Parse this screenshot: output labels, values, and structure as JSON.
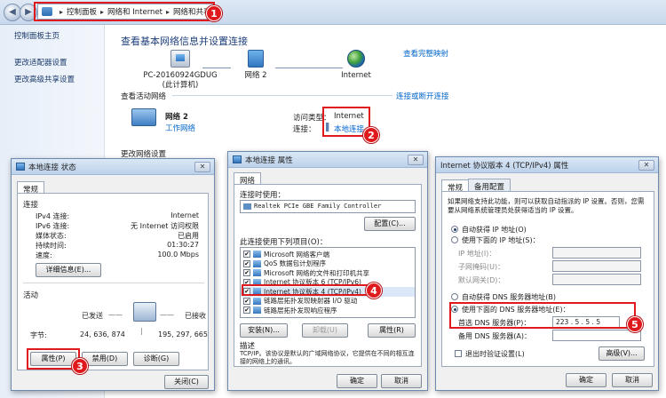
{
  "explorer": {
    "breadcrumb": [
      "控制面板",
      "网络和 Internet",
      "网络和共享中心"
    ],
    "leftnav": [
      "控制面板主页",
      "更改适配器设置",
      "更改高级共享设置"
    ],
    "title": "查看基本网络信息并设置连接",
    "full_map_link": "查看完整映射",
    "map": {
      "pc_name": "PC-20160924GDUG",
      "pc_sub": "(此计算机)",
      "network": "网络  2",
      "internet": "Internet"
    },
    "active_header": "查看活动网络",
    "connect_link": "连接或断开连接",
    "active": {
      "name": "网络  2",
      "type": "工作网络",
      "access_label": "访问类型：",
      "access_value": "Internet",
      "conn_label": "连接：",
      "conn_value": "本地连接"
    },
    "change_header": "更改网络设置"
  },
  "status_dialog": {
    "title": "本地连接 状态",
    "tab": "常规",
    "connection_group": "连接",
    "rows": [
      {
        "label": "IPv4 连接:",
        "value": "Internet"
      },
      {
        "label": "IPv6 连接:",
        "value": "无 Internet 访问权限"
      },
      {
        "label": "媒体状态:",
        "value": "已启用"
      },
      {
        "label": "持续时间:",
        "value": "01:30:27"
      },
      {
        "label": "速度:",
        "value": "100.0 Mbps"
      }
    ],
    "details_btn": "详细信息(E)...",
    "activity_group": "活动",
    "sent_label": "已发送",
    "recv_label": "已接收",
    "bytes_label": "字节:",
    "bytes_sent": "24, 636, 874",
    "bytes_recv": "195, 297, 665",
    "properties_btn": "属性(P)",
    "disable_btn": "禁用(D)",
    "diagnose_btn": "诊断(G)",
    "close_btn": "关闭(C)"
  },
  "props_dialog": {
    "title": "本地连接 属性",
    "tab": "网络",
    "connect_using_label": "连接时使用：",
    "adapter": "Realtek PCIe GBE Family Controller",
    "configure_btn": "配置(C)...",
    "items_label": "此连接使用下列项目(O)：",
    "items": [
      {
        "label": "Microsoft 网络客户端",
        "checked": true
      },
      {
        "label": "QoS 数据包计划程序",
        "checked": true
      },
      {
        "label": "Microsoft 网络的文件和打印机共享",
        "checked": true
      },
      {
        "label": "Internet 协议版本 6 (TCP/IPv6)",
        "checked": true
      },
      {
        "label": "Internet 协议版本 4 (TCP/IPv4)",
        "checked": true
      },
      {
        "label": "链路层拓扑发现映射器 I/O 驱动",
        "checked": true
      },
      {
        "label": "链路层拓扑发现响应程序",
        "checked": true
      }
    ],
    "install_btn": "安装(N)...",
    "uninstall_btn": "卸载(U)",
    "properties_btn": "属性(R)",
    "desc_label": "描述",
    "desc_text": "TCP/IP。该协议是默认的广域网络协议，它提供在不同的相互连接的网络上的通讯。",
    "ok_btn": "确定",
    "cancel_btn": "取消"
  },
  "ipv4_dialog": {
    "title": "Internet 协议版本 4 (TCP/IPv4) 属性",
    "tab_general": "常规",
    "tab_alt": "备用配置",
    "intro": "如果网络支持此功能，则可以获取自动指派的 IP 设置。否则，您需要从网络系统管理员处获得适当的 IP 设置。",
    "auto_ip": "自动获得 IP 地址(O)",
    "manual_ip": "使用下面的 IP 地址(S)：",
    "ip_label": "IP 地址(I)：",
    "mask_label": "子网掩码(U)：",
    "gateway_label": "默认网关(D)：",
    "auto_dns": "自动获得 DNS 服务器地址(B)",
    "manual_dns": "使用下面的 DNS 服务器地址(E)：",
    "pref_dns_label": "首选 DNS 服务器(P)：",
    "pref_dns_value": "223 . 5 . 5 . 5",
    "alt_dns_label": "备用 DNS 服务器(A)：",
    "validate": "退出时验证设置(L)",
    "advanced_btn": "高级(V)...",
    "ok_btn": "确定",
    "cancel_btn": "取消"
  },
  "callouts": [
    "1",
    "2",
    "3",
    "4",
    "5"
  ],
  "accent_red": "#e0191d",
  "link_blue": "#0066cc"
}
